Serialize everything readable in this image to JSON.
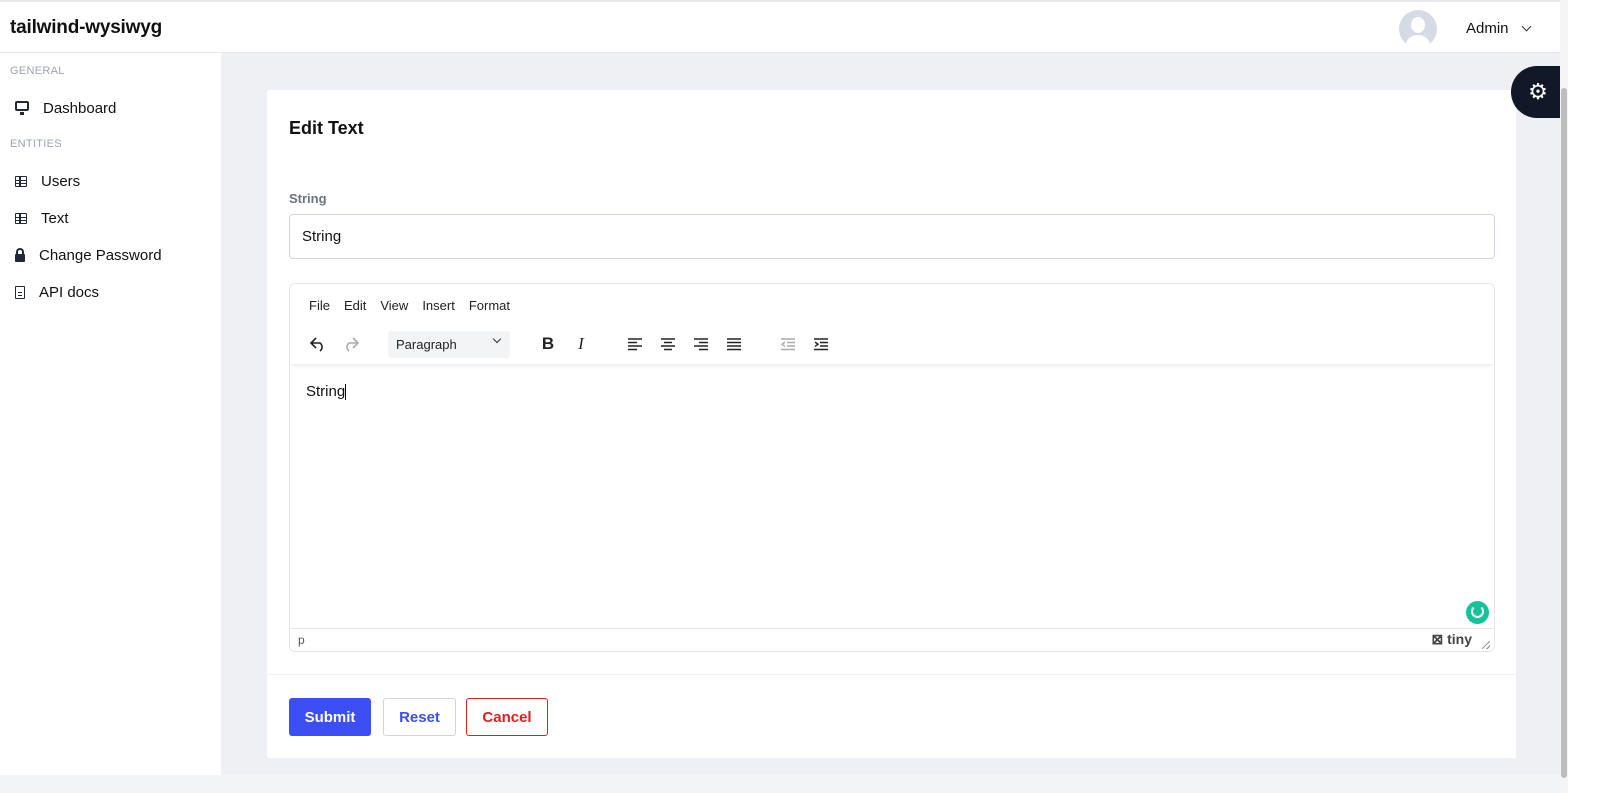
{
  "app": {
    "brand": "tailwind-wysiwyg"
  },
  "user": {
    "name": "Admin"
  },
  "sidebar": {
    "sections": [
      "GENERAL",
      "ENTITIES"
    ],
    "items": [
      {
        "label": "Dashboard",
        "icon": "monitor-icon"
      },
      {
        "label": "Users",
        "icon": "table-icon"
      },
      {
        "label": "Text",
        "icon": "table-icon"
      },
      {
        "label": "Change Password",
        "icon": "lock-icon"
      },
      {
        "label": "API docs",
        "icon": "document-icon"
      }
    ]
  },
  "page": {
    "title": "Edit Text",
    "field_label": "String",
    "field_value": "String"
  },
  "editor": {
    "menu": [
      "File",
      "Edit",
      "View",
      "Insert",
      "Format"
    ],
    "block_format": "Paragraph",
    "toolbar_glyphs": {
      "bold": "B",
      "italic": "I"
    },
    "content": "String",
    "path": "p",
    "brand": "tiny"
  },
  "actions": {
    "submit": "Submit",
    "reset": "Reset",
    "cancel": "Cancel"
  },
  "colors": {
    "primary": "#3b4ff5",
    "danger": "#e01e1e",
    "dark": "#111827",
    "background": "#eef0f4",
    "grammarly": "#15c39a"
  }
}
